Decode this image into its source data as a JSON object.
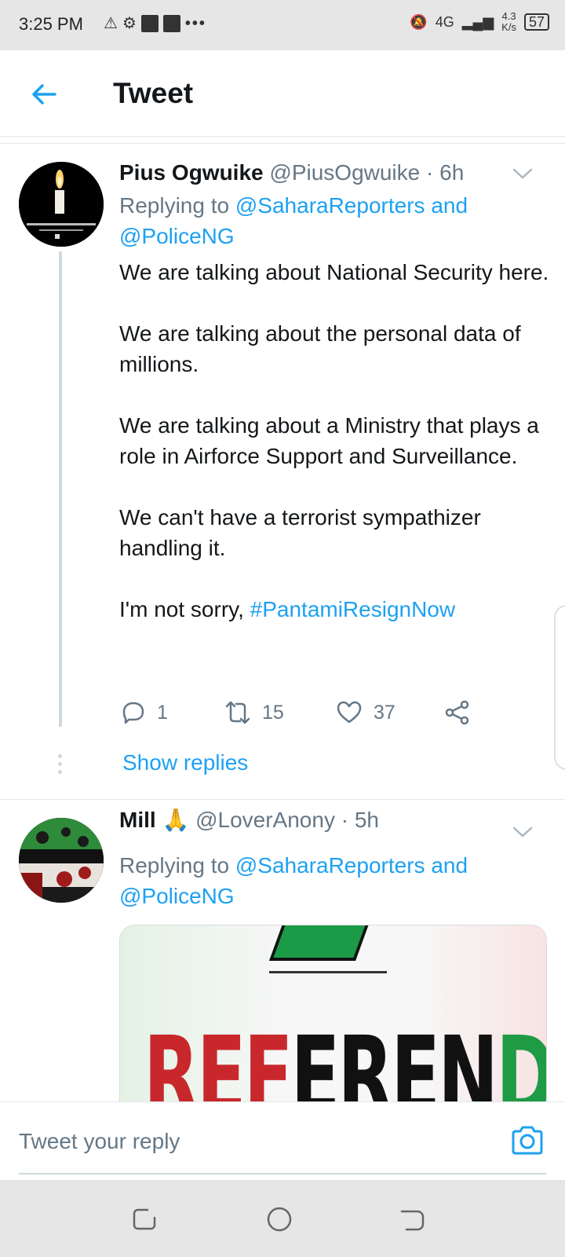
{
  "status_bar": {
    "time": "3:25 PM",
    "left_icons": [
      "warning-triangle-icon",
      "gear-icon",
      "facebook-icon",
      "facebook-icon",
      "more-dots-icon"
    ],
    "network": "4G",
    "speed_value": "4.3",
    "speed_unit": "K/s",
    "battery": "57"
  },
  "header": {
    "title": "Tweet"
  },
  "tweets": [
    {
      "name": "Pius Ogwuike",
      "handle": "@PiusOgwuike",
      "time": "· 6h",
      "reply_prefix": "Replying to",
      "reply_mention_1": "@SaharaReporters",
      "reply_and": "and",
      "reply_mention_2": "@PoliceNG",
      "paragraphs": [
        "We are talking about National Security here.",
        "We are talking about the personal data of millions.",
        "We are talking about a Ministry that plays a role in Airforce Support and Surveillance.",
        "We can't have a terrorist sympathizer handling it."
      ],
      "last_line_text": "I'm not sorry,",
      "hashtag": "#PantamiResignNow",
      "replies": "1",
      "retweets": "15",
      "likes": "37",
      "show_replies": "Show replies"
    },
    {
      "name": "Mill 🙏",
      "handle": "@LoverAnony",
      "time": "· 5h",
      "reply_prefix": "Replying to",
      "reply_mention_1": "@SaharaReporters",
      "reply_and": "and",
      "reply_mention_2": "@PoliceNG",
      "media_text_red": "REF",
      "media_text_black": "EREN",
      "media_text_green": "DUM"
    }
  ],
  "reply_bar": {
    "placeholder": "Tweet your reply"
  },
  "colors": {
    "accent": "#1da1f2",
    "secondary_text": "#657786"
  }
}
